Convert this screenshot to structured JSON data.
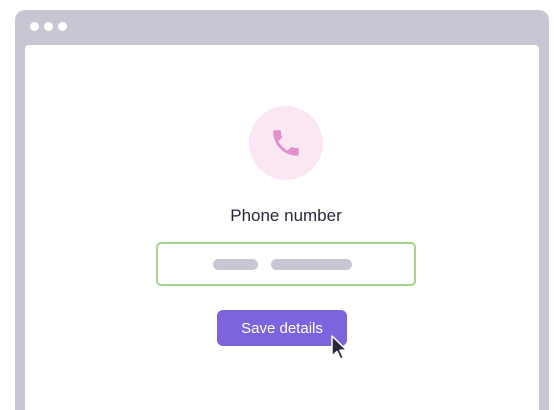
{
  "window": {
    "controls": [
      "dot",
      "dot",
      "dot"
    ]
  },
  "form": {
    "icon": "phone-icon",
    "label": "Phone number",
    "input_value_placeholder_bars": 2,
    "save_label": "Save details"
  },
  "colors": {
    "frame": "#c8c6d3",
    "icon_bg": "#fbe6f4",
    "icon": "#e48fcb",
    "input_border": "#a4d48a",
    "button": "#7d63de",
    "cursor": "#2a2838"
  }
}
